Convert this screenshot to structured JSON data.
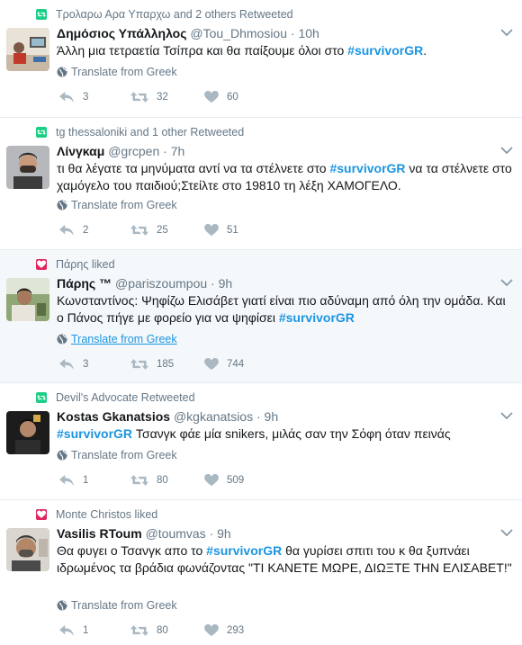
{
  "tweets": [
    {
      "context": "Τρολαρω Αρα Υπαρχω and 2 others Retweeted",
      "context_type": "retweet",
      "name": "Δημόσιος Υπάλληλος",
      "handle": "@Tou_Dhmosiou",
      "time": "· 10h",
      "text_plain": "Άλλη μια τετραετία Τσίπρα και θα παίξουμε όλοι στο ",
      "hashtag": "#survivorGR",
      "text_after": ".",
      "translate": "Translate from Greek",
      "replies": "3",
      "retweets": "32",
      "likes": "60"
    },
    {
      "context": "tg thessaloniki and 1 other Retweeted",
      "context_type": "retweet",
      "name": "Λίνγκαμ",
      "handle": "@grcpen",
      "time": "· 7h",
      "text_before": "τι θα λέγατε τα μηνύματα αντί να τα στέλνετε στο ",
      "hashtag": "#survivorGR",
      "text_after": " να τα στέλνετε στο χαμόγελο του παιδιού;Στείλτε στο 19810 τη λέξη ΧΑΜΟΓΕΛΟ.",
      "translate": "Translate from Greek",
      "replies": "2",
      "retweets": "25",
      "likes": "51"
    },
    {
      "context": "Πάρης liked",
      "context_type": "like",
      "name": "Πάρης ™",
      "handle": "@pariszoumpou",
      "time": "· 9h",
      "text_before": "Κωνσταντίνος: Ψηφίζω Ελισάβετ γιατί είναι πιο αδύναμη από όλη την ομάδα. Και ο Πάνος πήγε με φορείο για να ψηφίσει ",
      "hashtag": "#survivorGR",
      "text_after": "",
      "translate": "Translate from Greek",
      "replies": "3",
      "retweets": "185",
      "likes": "744"
    },
    {
      "context": "Devil's Advocate Retweeted",
      "context_type": "retweet",
      "name": "Kostas Gkanatsios",
      "handle": "@kgkanatsios",
      "time": "· 9h",
      "text_before": "",
      "hashtag": "#survivorGR",
      "text_after": " Τσανγκ φάε μία snikers, μιλάς σαν την Σόφη όταν πεινάς",
      "translate": "Translate from Greek",
      "replies": "1",
      "retweets": "80",
      "likes": "509"
    },
    {
      "context": "Monte Christos liked",
      "context_type": "like",
      "name": "Vasilis RToum",
      "handle": "@toumvas",
      "time": "· 9h",
      "text_before": "Θα φυγει ο Τσανγκ απο το ",
      "hashtag": "#survivorGR",
      "text_after": " θα γυρίσει σπιτι του κ θα ξυπνάει ιδρωμένος τα βράδια φωνάζοντας \"ΤΙ ΚΑΝΕΤΕ ΜΩΡΕ, ΔΙΩΞΤΕ ΤΗΝ ΕΛΙΣΑΒΕΤ!\"",
      "translate": "Translate from Greek",
      "replies": "1",
      "retweets": "80",
      "likes": "293"
    }
  ],
  "colors": {
    "retweet": "#19cf86",
    "like": "#e0245e",
    "link": "#1b95e0",
    "muted": "#657786"
  },
  "icons": [
    "retweet-context-icon",
    "like-context-icon",
    "reply-icon",
    "retweet-icon",
    "heart-icon",
    "globe-icon",
    "chevron-down-icon"
  ]
}
